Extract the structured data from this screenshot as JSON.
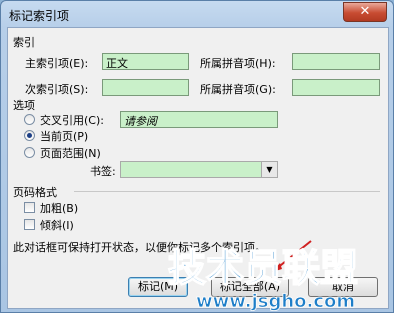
{
  "window": {
    "title": "标记索引项",
    "close_label": "✕"
  },
  "index": {
    "group_label": "索引",
    "main_entry": {
      "label": "主索引项(E):",
      "value": "正文"
    },
    "main_pinyin": {
      "label": "所属拼音项(H):",
      "value": ""
    },
    "sub_entry": {
      "label": "次索引项(S):",
      "value": ""
    },
    "sub_pinyin": {
      "label": "所属拼音项(G):",
      "value": ""
    }
  },
  "options": {
    "group_label": "选项",
    "cross_ref": {
      "label": "交叉引用(C):",
      "value": "请参阅",
      "selected": false
    },
    "current_page": {
      "label": "当前页(P)",
      "selected": true
    },
    "page_range": {
      "label": "页面范围(N)",
      "selected": false
    },
    "bookmark": {
      "label": "书签:",
      "value": ""
    }
  },
  "page_format": {
    "group_label": "页码格式",
    "bold": {
      "label": "加粗(B)",
      "checked": false
    },
    "italic": {
      "label": "倾斜(I)",
      "checked": false
    }
  },
  "hint_text": "此对话框可保持打开状态，以便你标记多个索引项。",
  "buttons": {
    "mark": "标记(M)",
    "mark_all": "标记全部(A)",
    "cancel": "取消"
  },
  "watermark": {
    "text": "技术员联盟",
    "url": "www.jsgho.com"
  },
  "colors": {
    "field_bg": "#c9f0c9",
    "watermark": "#1e7ec8",
    "arrow": "#d02020"
  }
}
